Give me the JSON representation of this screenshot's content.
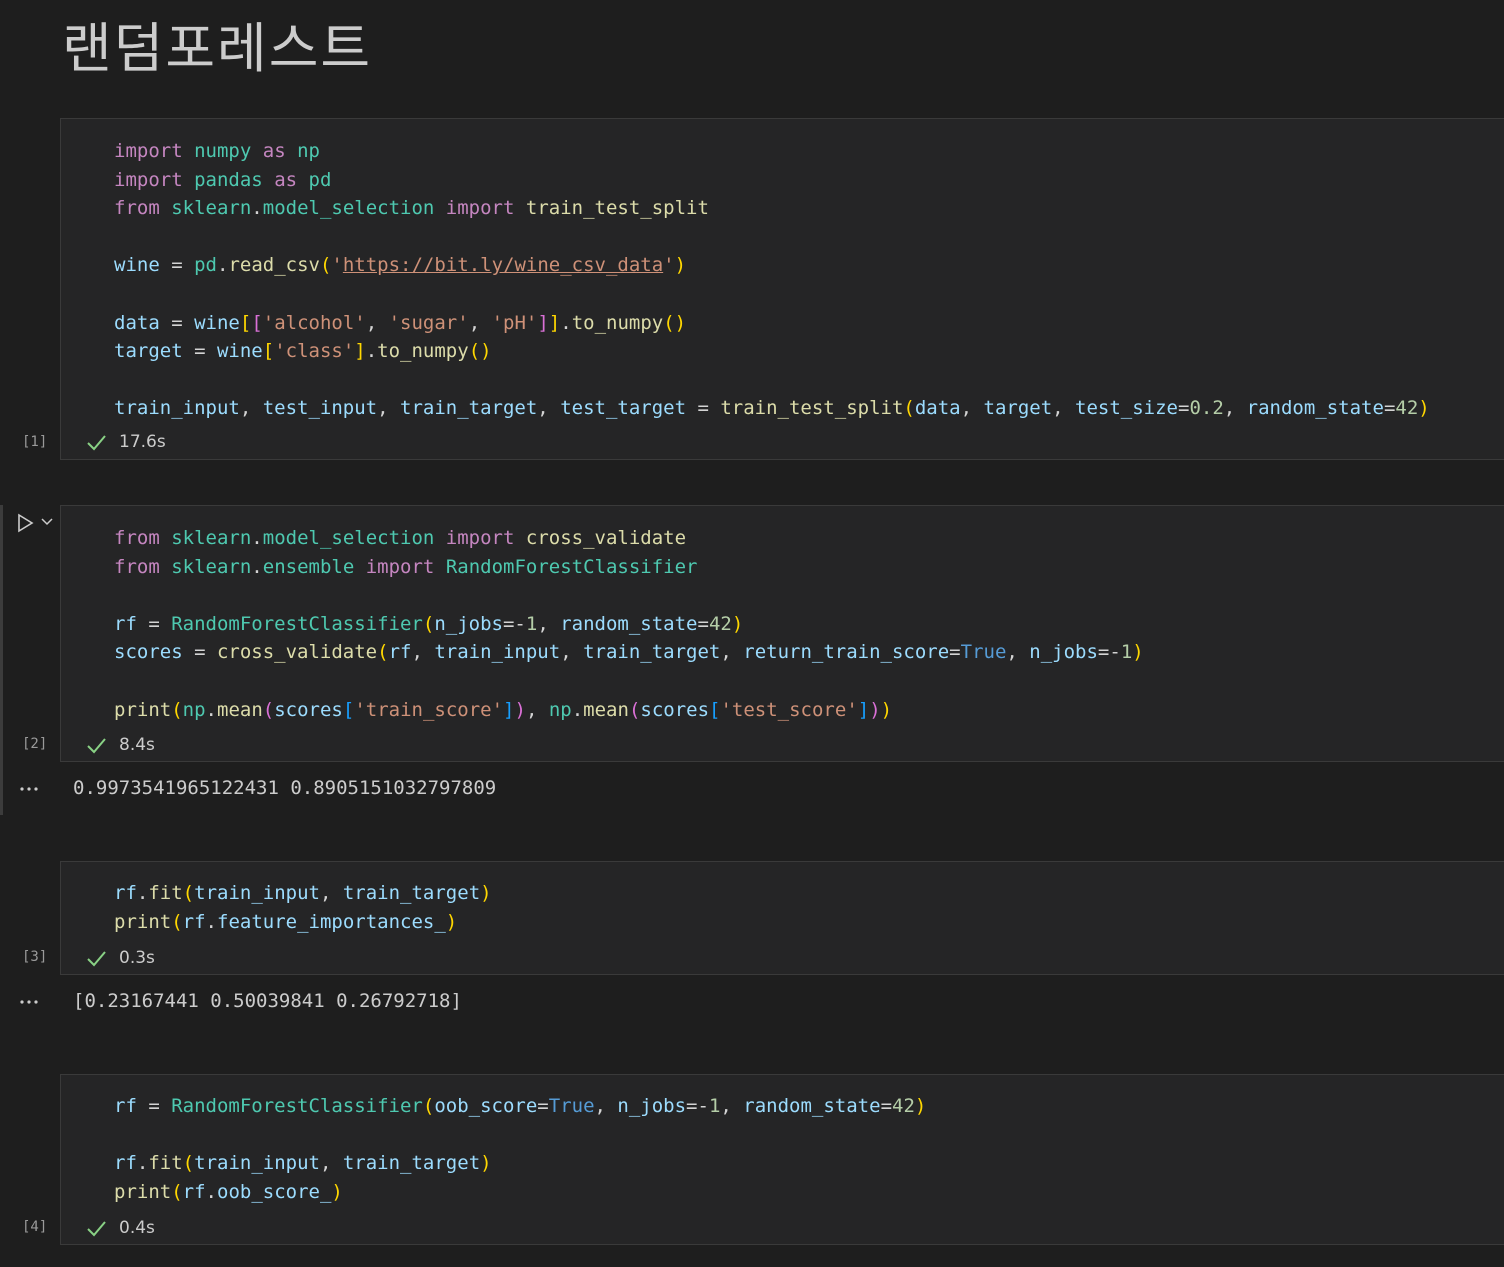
{
  "title": "랜덤포레스트",
  "cells": [
    {
      "exec_count": "[1]",
      "duration": "17.6s",
      "code": {
        "l1_import": "import",
        "l1_mod": "numpy",
        "l1_as": "as",
        "l1_alias": "np",
        "l2_import": "import",
        "l2_mod": "pandas",
        "l2_as": "as",
        "l2_alias": "pd",
        "l3_from": "from",
        "l3_mod": "sklearn",
        "l3_sub": "model_selection",
        "l3_import": "import",
        "l3_fn": "train_test_split",
        "l5_var": "wine",
        "l5_pd": "pd",
        "l5_fn": "read_csv",
        "l5_url": "https://bit.ly/wine_csv_data",
        "l7_var": "data",
        "l7_wine": "wine",
        "l7_s1": "'alcohol'",
        "l7_s2": "'sugar'",
        "l7_s3": "'pH'",
        "l7_fn": "to_numpy",
        "l8_var": "target",
        "l8_wine": "wine",
        "l8_s1": "'class'",
        "l8_fn": "to_numpy",
        "l10_v1": "train_input",
        "l10_v2": "test_input",
        "l10_v3": "train_target",
        "l10_v4": "test_target",
        "l10_fn": "train_test_split",
        "l10_a1": "data",
        "l10_a2": "target",
        "l10_k1": "test_size",
        "l10_n1": "0.2",
        "l10_k2": "random_state",
        "l10_n2": "42"
      }
    },
    {
      "exec_count": "[2]",
      "duration": "8.4s",
      "code": {
        "l1_from": "from",
        "l1_mod": "sklearn",
        "l1_sub": "model_selection",
        "l1_import": "import",
        "l1_fn": "cross_validate",
        "l2_from": "from",
        "l2_mod": "sklearn",
        "l2_sub": "ensemble",
        "l2_import": "import",
        "l2_cls": "RandomForestClassifier",
        "l4_var": "rf",
        "l4_cls": "RandomForestClassifier",
        "l4_k1": "n_jobs",
        "l4_n1": "1",
        "l4_k2": "random_state",
        "l4_n2": "42",
        "l5_var": "scores",
        "l5_fn": "cross_validate",
        "l5_a1": "rf",
        "l5_a2": "train_input",
        "l5_a3": "train_target",
        "l5_k1": "return_train_score",
        "l5_c1": "True",
        "l5_k2": "n_jobs",
        "l5_n2": "1",
        "l7_fn": "print",
        "l7_np": "np",
        "l7_mean": "mean",
        "l7_sc": "scores",
        "l7_s1": "'train_score'",
        "l7_np2": "np",
        "l7_mean2": "mean",
        "l7_sc2": "scores",
        "l7_s2": "'test_score'"
      },
      "output": "0.9973541965122431 0.8905151032797809"
    },
    {
      "exec_count": "[3]",
      "duration": "0.3s",
      "code": {
        "l1_rf": "rf",
        "l1_fn": "fit",
        "l1_a1": "train_input",
        "l1_a2": "train_target",
        "l2_fn": "print",
        "l2_rf": "rf",
        "l2_attr": "feature_importances_"
      },
      "output": "[0.23167441 0.50039841 0.26792718]"
    },
    {
      "exec_count": "[4]",
      "duration": "0.4s",
      "code": {
        "l1_var": "rf",
        "l1_cls": "RandomForestClassifier",
        "l1_k1": "oob_score",
        "l1_c1": "True",
        "l1_k2": "n_jobs",
        "l1_n2": "1",
        "l1_k3": "random_state",
        "l1_n3": "42",
        "l3_rf": "rf",
        "l3_fn": "fit",
        "l3_a1": "train_input",
        "l3_a2": "train_target",
        "l4_fn": "print",
        "l4_rf": "rf",
        "l4_attr": "oob_score_"
      }
    }
  ],
  "icons": {
    "check": "check-icon",
    "run": "play-icon",
    "run_menu": "chevron-down-icon",
    "output_menu": "ellipsis-icon"
  },
  "colors": {
    "background": "#1e1e1e",
    "cell_background": "#252526",
    "success": "#89d185"
  }
}
